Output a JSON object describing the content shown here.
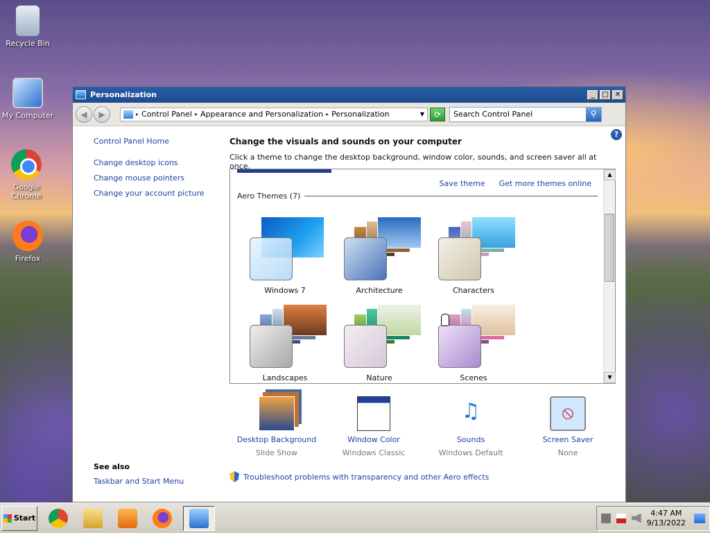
{
  "desktop": {
    "icons": [
      {
        "label": "Recycle Bin",
        "icon": "recycle-bin-icon"
      },
      {
        "label": "My Computer",
        "icon": "computer-icon"
      },
      {
        "label": "Google Chrome",
        "icon": "chrome-icon"
      },
      {
        "label": "Firefox",
        "icon": "firefox-icon"
      }
    ]
  },
  "window": {
    "title": "Personalization",
    "address": {
      "crumbs": [
        "Control Panel",
        "Appearance and Personalization",
        "Personalization"
      ]
    },
    "search": {
      "placeholder": "Search Control Panel"
    },
    "left_pane": {
      "home": "Control Panel Home",
      "links": [
        "Change desktop icons",
        "Change mouse pointers",
        "Change your account picture"
      ],
      "see_also": {
        "heading": "See also",
        "links": [
          "Taskbar and Start Menu"
        ]
      }
    },
    "main": {
      "heading": "Change the visuals and sounds on your computer",
      "subheading": "Click a theme to change the desktop background, window color, sounds, and screen saver all at once.",
      "save_theme": "Save theme",
      "get_more": "Get more themes online",
      "group_label": "Aero Themes (7)",
      "themes": [
        "Windows 7",
        "Architecture",
        "Characters",
        "Landscapes",
        "Nature",
        "Scenes"
      ]
    },
    "bottom": [
      {
        "title": "Desktop Background",
        "subtitle": "Slide Show"
      },
      {
        "title": "Window Color",
        "subtitle": "Windows Classic"
      },
      {
        "title": "Sounds",
        "subtitle": "Windows Default"
      },
      {
        "title": "Screen Saver",
        "subtitle": "None"
      }
    ],
    "troubleshoot": "Troubleshoot problems with transparency and other Aero effects"
  },
  "taskbar": {
    "start_label": "Start",
    "clock_time": "4:47 AM",
    "clock_date": "9/13/2022"
  }
}
